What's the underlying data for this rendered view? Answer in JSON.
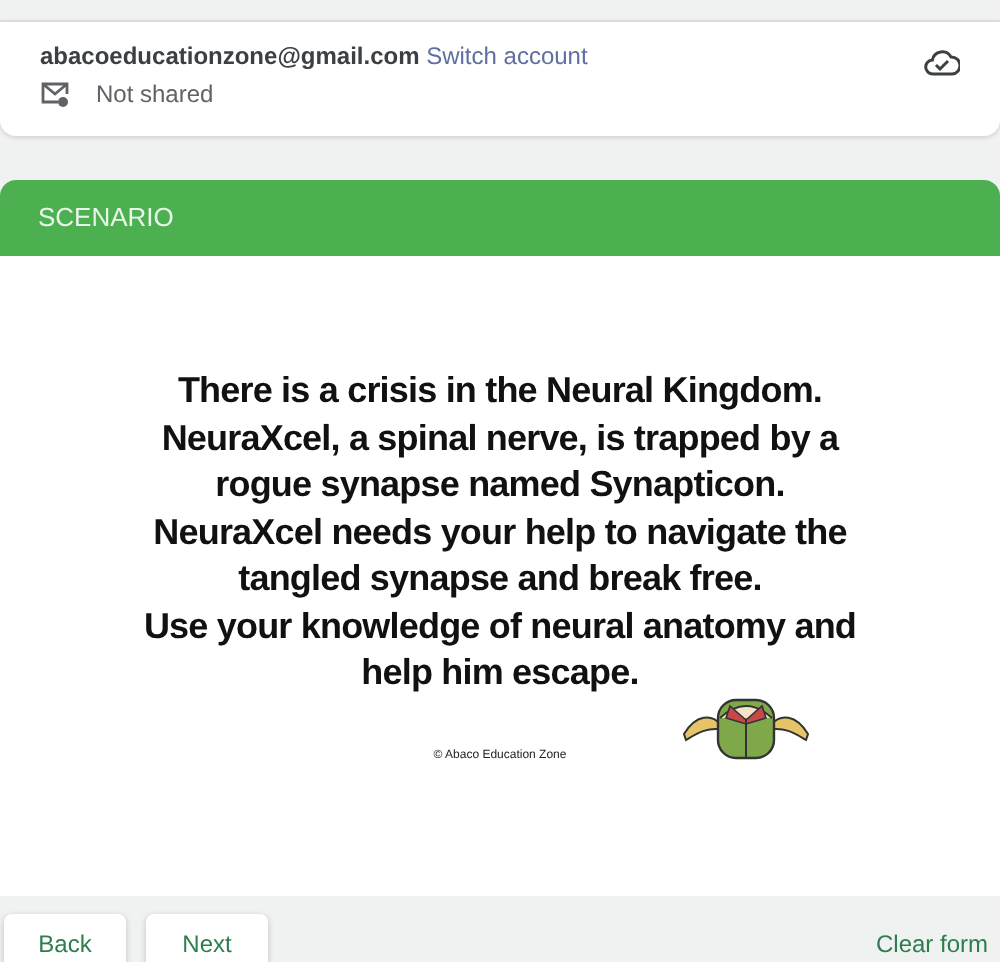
{
  "account": {
    "email": "abacoeducationzone@gmail.com",
    "switch_link": "Switch account",
    "sharing": "Not shared"
  },
  "section": {
    "title": "SCENARIO",
    "image": {
      "lines": [
        "There is a crisis in the Neural Kingdom.",
        "NeuraXcel, a spinal nerve, is trapped by a",
        "rogue synapse named Synapticon.",
        "NeuraXcel needs your help to navigate the",
        "tangled synapse and break free.",
        "Use your knowledge of neural anatomy and",
        "help him escape."
      ],
      "credit": "© Abaco Education Zone"
    }
  },
  "navigation": {
    "buttons": [
      {
        "label": "Back"
      },
      {
        "label": "Next"
      }
    ],
    "clear_link": "Clear form"
  }
}
